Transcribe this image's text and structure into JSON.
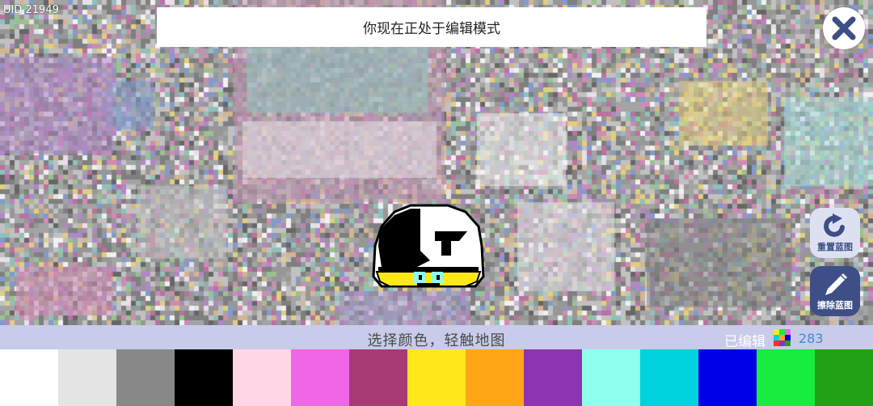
{
  "uid": "UID 21949",
  "banner": {
    "text": "你现在正处于编辑模式"
  },
  "close_icon": "close-x-icon",
  "side_buttons": {
    "reset_label": "重置蓝图",
    "reset_icon": "rotate-refresh-icon",
    "erase_label": "擦除蓝图",
    "erase_icon": "pencil-icon"
  },
  "hint_bar": {
    "hint": "选择颜色，轻触地图",
    "edited_label": "已编辑",
    "edited_icon": "color-grid-icon",
    "edited_count": "283"
  },
  "palette": [
    "#ffffff",
    "#e4e4e4",
    "#888888",
    "#000000",
    "#ffd6e6",
    "#ef66e6",
    "#a83a74",
    "#ffe81a",
    "#ffa616",
    "#8e33b2",
    "#8fffee",
    "#00d3dd",
    "#0000e8",
    "#18ec3f",
    "#23a217"
  ],
  "canvas_palette": [
    "#7a7a7a",
    "#8b8b8b",
    "#5c5c5c",
    "#b0b0b0",
    "#c46a9e",
    "#9b66b8",
    "#6fb0a8",
    "#d8c25c",
    "#7fb070",
    "#5f7ec0",
    "#e0d8e0",
    "#a84a84",
    "#3c3c3c",
    "#eeeeee",
    "#c8a070"
  ]
}
